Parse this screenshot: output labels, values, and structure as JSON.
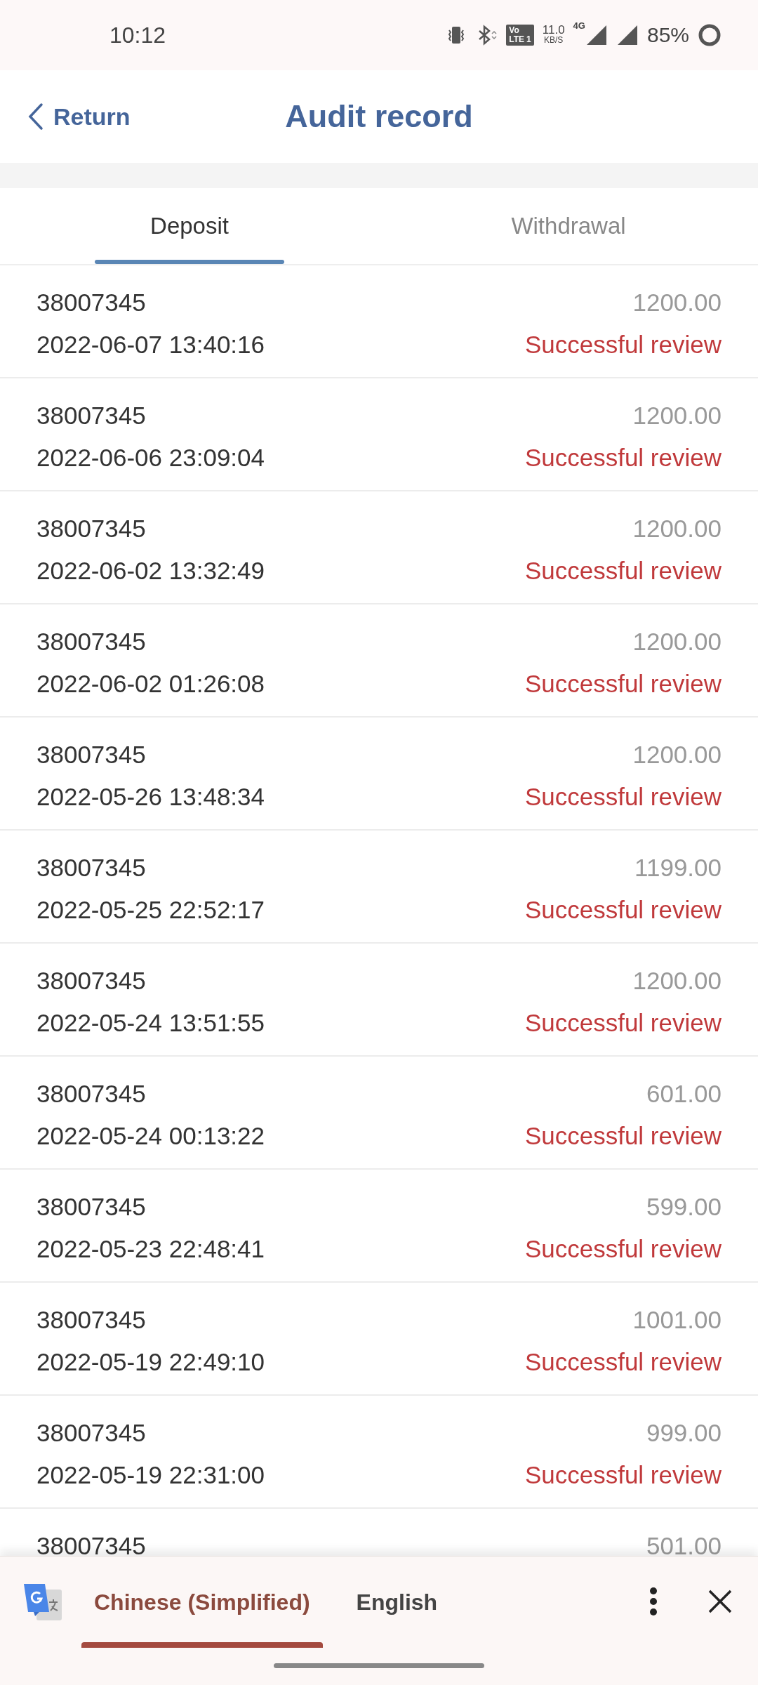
{
  "status_bar": {
    "time": "10:12",
    "volte": {
      "top": "Vo",
      "bottom": "LTE",
      "slot": "1"
    },
    "speed_value": "11.0",
    "speed_unit": "KB/S",
    "network": "4G",
    "battery": "85%"
  },
  "header": {
    "back": "Return",
    "title": "Audit record"
  },
  "tabs": [
    {
      "label": "Deposit",
      "selected": true
    },
    {
      "label": "Withdrawal",
      "selected": false
    }
  ],
  "records": [
    {
      "id": "38007345",
      "amount": "1200.00",
      "time": "2022-06-07 13:40:16",
      "status": "Successful review"
    },
    {
      "id": "38007345",
      "amount": "1200.00",
      "time": "2022-06-06 23:09:04",
      "status": "Successful review"
    },
    {
      "id": "38007345",
      "amount": "1200.00",
      "time": "2022-06-02 13:32:49",
      "status": "Successful review"
    },
    {
      "id": "38007345",
      "amount": "1200.00",
      "time": "2022-06-02 01:26:08",
      "status": "Successful review"
    },
    {
      "id": "38007345",
      "amount": "1200.00",
      "time": "2022-05-26 13:48:34",
      "status": "Successful review"
    },
    {
      "id": "38007345",
      "amount": "1199.00",
      "time": "2022-05-25 22:52:17",
      "status": "Successful review"
    },
    {
      "id": "38007345",
      "amount": "1200.00",
      "time": "2022-05-24 13:51:55",
      "status": "Successful review"
    },
    {
      "id": "38007345",
      "amount": "601.00",
      "time": "2022-05-24 00:13:22",
      "status": "Successful review"
    },
    {
      "id": "38007345",
      "amount": "599.00",
      "time": "2022-05-23 22:48:41",
      "status": "Successful review"
    },
    {
      "id": "38007345",
      "amount": "1001.00",
      "time": "2022-05-19 22:49:10",
      "status": "Successful review"
    },
    {
      "id": "38007345",
      "amount": "999.00",
      "time": "2022-05-19 22:31:00",
      "status": "Successful review"
    },
    {
      "id": "38007345",
      "amount": "501.00"
    }
  ],
  "translate_bar": {
    "languages": [
      {
        "label": "Chinese (Simplified)",
        "selected": true
      },
      {
        "label": "English",
        "selected": false
      }
    ]
  }
}
